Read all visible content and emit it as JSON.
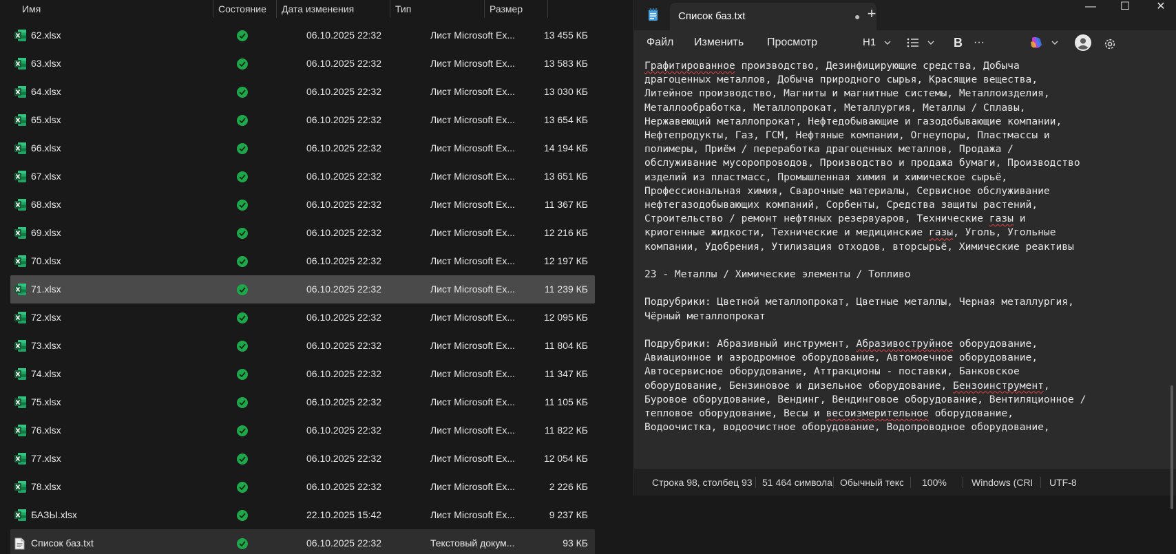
{
  "explorer": {
    "columns": {
      "name": "Имя",
      "status": "Состояние",
      "modified": "Дата изменения",
      "type": "Тип",
      "size": "Размер"
    },
    "files": [
      {
        "name": "62.xlsx",
        "modified": "06.10.2025 22:32",
        "type": "Лист Microsoft Ex...",
        "size": "13 455 КБ",
        "icon": "excel-icon"
      },
      {
        "name": "63.xlsx",
        "modified": "06.10.2025 22:32",
        "type": "Лист Microsoft Ex...",
        "size": "13 583 КБ",
        "icon": "excel-icon"
      },
      {
        "name": "64.xlsx",
        "modified": "06.10.2025 22:32",
        "type": "Лист Microsoft Ex...",
        "size": "13 030 КБ",
        "icon": "excel-icon"
      },
      {
        "name": "65.xlsx",
        "modified": "06.10.2025 22:32",
        "type": "Лист Microsoft Ex...",
        "size": "13 654 КБ",
        "icon": "excel-icon"
      },
      {
        "name": "66.xlsx",
        "modified": "06.10.2025 22:32",
        "type": "Лист Microsoft Ex...",
        "size": "14 194 КБ",
        "icon": "excel-icon"
      },
      {
        "name": "67.xlsx",
        "modified": "06.10.2025 22:32",
        "type": "Лист Microsoft Ex...",
        "size": "13 651 КБ",
        "icon": "excel-icon"
      },
      {
        "name": "68.xlsx",
        "modified": "06.10.2025 22:32",
        "type": "Лист Microsoft Ex...",
        "size": "11 367 КБ",
        "icon": "excel-icon"
      },
      {
        "name": "69.xlsx",
        "modified": "06.10.2025 22:32",
        "type": "Лист Microsoft Ex...",
        "size": "12 216 КБ",
        "icon": "excel-icon"
      },
      {
        "name": "70.xlsx",
        "modified": "06.10.2025 22:32",
        "type": "Лист Microsoft Ex...",
        "size": "12 197 КБ",
        "icon": "excel-icon"
      },
      {
        "name": "71.xlsx",
        "modified": "06.10.2025 22:32",
        "type": "Лист Microsoft Ex...",
        "size": "11 239 КБ",
        "icon": "excel-icon",
        "selected": true
      },
      {
        "name": "72.xlsx",
        "modified": "06.10.2025 22:32",
        "type": "Лист Microsoft Ex...",
        "size": "12 095 КБ",
        "icon": "excel-icon"
      },
      {
        "name": "73.xlsx",
        "modified": "06.10.2025 22:32",
        "type": "Лист Microsoft Ex...",
        "size": "11 804 КБ",
        "icon": "excel-icon"
      },
      {
        "name": "74.xlsx",
        "modified": "06.10.2025 22:32",
        "type": "Лист Microsoft Ex...",
        "size": "11 347 КБ",
        "icon": "excel-icon"
      },
      {
        "name": "75.xlsx",
        "modified": "06.10.2025 22:32",
        "type": "Лист Microsoft Ex...",
        "size": "11 105 КБ",
        "icon": "excel-icon"
      },
      {
        "name": "76.xlsx",
        "modified": "06.10.2025 22:32",
        "type": "Лист Microsoft Ex...",
        "size": "11 822 КБ",
        "icon": "excel-icon"
      },
      {
        "name": "77.xlsx",
        "modified": "06.10.2025 22:32",
        "type": "Лист Microsoft Ex...",
        "size": "12 054 КБ",
        "icon": "excel-icon"
      },
      {
        "name": "78.xlsx",
        "modified": "06.10.2025 22:32",
        "type": "Лист Microsoft Ex...",
        "size": "2 226 КБ",
        "icon": "excel-icon"
      },
      {
        "name": "БАЗЫ.xlsx",
        "modified": "22.10.2025 15:42",
        "type": "Лист Microsoft Ex...",
        "size": "9 237 КБ",
        "icon": "excel-icon"
      },
      {
        "name": "Список баз.txt",
        "modified": "06.10.2025 22:32",
        "type": "Текстовый докум...",
        "size": "93 КБ",
        "icon": "text-file-icon",
        "selected_dim": true
      }
    ]
  },
  "notepad": {
    "tab_title": "Список баз.txt",
    "tab_dot": "●",
    "new_tab": "+",
    "window": {
      "minimize": "—",
      "maximize": "☐",
      "close": "✕"
    },
    "menu": {
      "file": "Файл",
      "edit": "Изменить",
      "view": "Просмотр"
    },
    "toolbar": {
      "heading": "H1",
      "bold": "B",
      "more": "···"
    },
    "lines": [
      "Графитированное производство, Дезинфицирующие средства, Добыча",
      "драгоценных металлов, Добыча природного сырья, Красящие вещества,",
      "Литейное производство, Магниты и магнитные системы, Металлоизделия,",
      "Металлообработка, Металлопрокат, Металлургия, Металлы / Сплавы,",
      "Нержавеющий металлопрокат, Нефтедобывающие и газодобывающие компании,",
      "Нефтепродукты, Газ, ГСМ, Нефтяные компании, Огнеупоры, Пластмассы и",
      "полимеры, Приём / переработка драгоценных металлов, Продажа /",
      "обслуживание мусоропроводов, Производство и продажа бумаги, Производство",
      "изделий из пластмасс, Промышленная химия и химическое сырьё,",
      "Профессиональная химия, Сварочные материалы, Сервисное обслуживание",
      "нефтегазодобывающих компаний, Сорбенты, Средства защиты растений,",
      "Строительство / ремонт нефтяных резервуаров, Технические газы и",
      "криогенные жидкости, Технические и медицинские газы, Уголь, Угольные",
      "компании, Удобрения, Утилизация отходов, вторсырьё, Химические реактивы",
      "",
      "23 - Металлы / Химические элементы / Топливо",
      "",
      "Подрубрики: Цветной металлопрокат, Цветные металлы, Черная металлургия,",
      "Чёрный металлопрокат",
      "",
      "Подрубрики: Абразивный инструмент, Абразивоструйное оборудование,",
      "Авиационное и аэродромное оборудование, Автомоечное оборудование,",
      "Автосервисное оборудование, Аттракционы - поставки, Банковское",
      "оборудование, Бензиновое и дизельное оборудование, Бензоинструмент,",
      "Буровое оборудование, Вендинг, Вендинговое оборудование, Вентиляционное /",
      "тепловое оборудование, Весы и весоизмерительное оборудование,",
      "Водоочистка, водоочистное оборудование, Водопроводное оборудование,"
    ],
    "status": {
      "position": "Строка 98, столбец 93",
      "chars": "51 464 символа",
      "format": "Обычный текст",
      "zoom": "100%",
      "eol": "Windows (CRLF)",
      "encoding": "UTF-8"
    }
  }
}
